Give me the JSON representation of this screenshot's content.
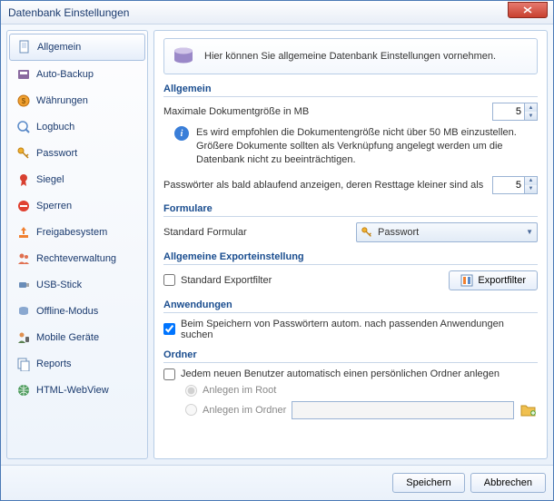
{
  "window": {
    "title": "Datenbank Einstellungen"
  },
  "banner": {
    "text": "Hier können Sie allgemeine Datenbank Einstellungen vornehmen."
  },
  "sidebar": {
    "items": [
      {
        "label": "Allgemein"
      },
      {
        "label": "Auto-Backup"
      },
      {
        "label": "Währungen"
      },
      {
        "label": "Logbuch"
      },
      {
        "label": "Passwort"
      },
      {
        "label": "Siegel"
      },
      {
        "label": "Sperren"
      },
      {
        "label": "Freigabesystem"
      },
      {
        "label": "Rechteverwaltung"
      },
      {
        "label": "USB-Stick"
      },
      {
        "label": "Offline-Modus"
      },
      {
        "label": "Mobile Geräte"
      },
      {
        "label": "Reports"
      },
      {
        "label": "HTML-WebView"
      }
    ]
  },
  "sections": {
    "allgemein": {
      "title": "Allgemein",
      "max_doc_label": "Maximale Dokumentgröße in MB",
      "max_doc_value": "5",
      "info": "Es wird empfohlen die Dokumentengröße nicht über 50 MB einzustellen. Größere Dokumente sollten als Verknüpfung angelegt werden um die Datenbank nicht zu beeinträchtigen.",
      "pwd_expire_label": "Passwörter als bald ablaufend anzeigen, deren Resttage kleiner sind als",
      "pwd_expire_value": "5"
    },
    "formulare": {
      "title": "Formulare",
      "std_form_label": "Standard Formular",
      "std_form_value": "Passwort"
    },
    "export": {
      "title": "Allgemeine Exporteinstellung",
      "std_filter_label": "Standard Exportfilter",
      "filter_btn": "Exportfilter"
    },
    "anwendungen": {
      "title": "Anwendungen",
      "auto_search_label": "Beim Speichern von Passwörtern autom. nach passenden Anwendungen suchen"
    },
    "ordner": {
      "title": "Ordner",
      "auto_folder_label": "Jedem neuen Benutzer automatisch einen persönlichen Ordner anlegen",
      "root_label": "Anlegen im Root",
      "ordner_label": "Anlegen im Ordner",
      "ordner_path": ""
    }
  },
  "footer": {
    "save": "Speichern",
    "cancel": "Abbrechen"
  }
}
